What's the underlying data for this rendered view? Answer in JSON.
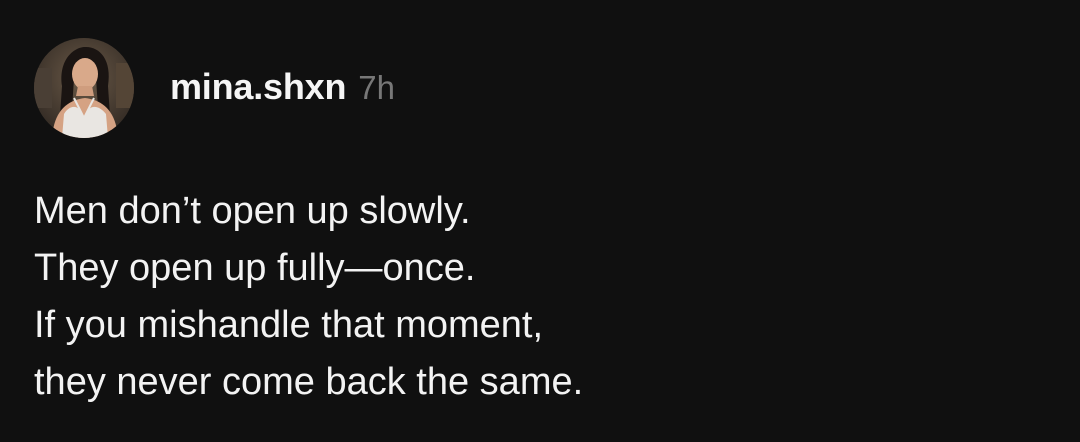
{
  "post": {
    "author": {
      "username": "mina.shxn",
      "avatar_icon": "profile-photo"
    },
    "timestamp": "7h",
    "lines": [
      "Men don’t open up slowly.",
      "They open up fully—once.",
      "If you mishandle that moment,",
      "they never come back the same."
    ]
  },
  "colors": {
    "background": "#101010",
    "text": "#f3f3f3",
    "timestamp": "#777777"
  }
}
